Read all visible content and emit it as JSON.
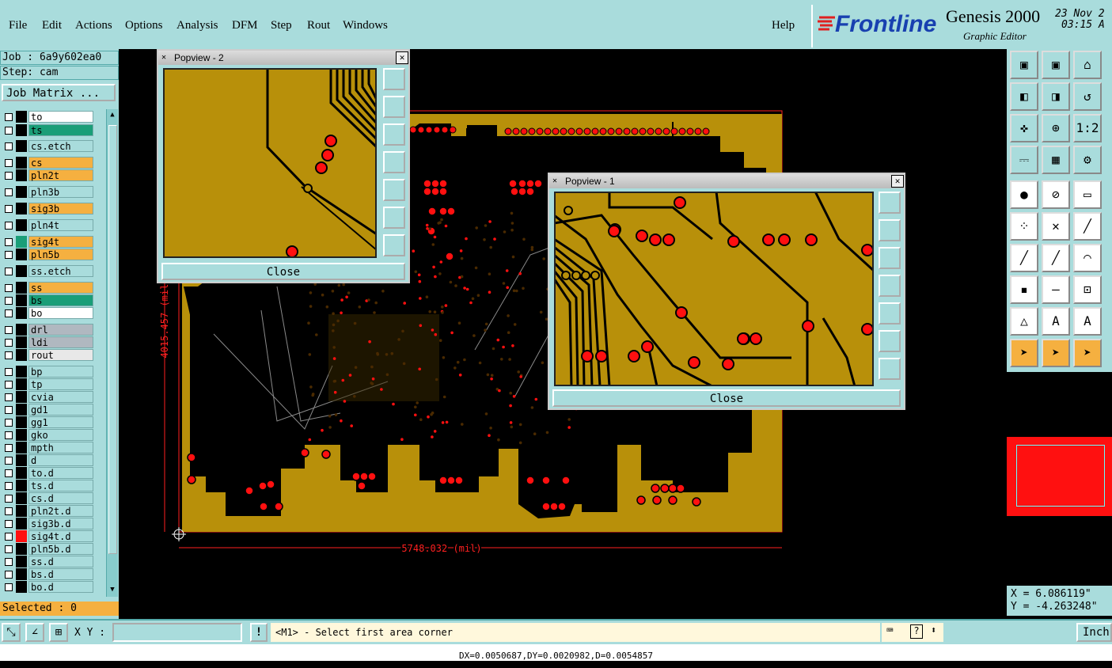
{
  "menu": {
    "items": [
      "File",
      "Edit",
      "Actions",
      "Options",
      "Analysis",
      "DFM",
      "Step",
      "Rout",
      "Windows"
    ],
    "help": "Help"
  },
  "brand": {
    "logo": "Frontline",
    "product": "Genesis 2000",
    "subtitle": "Graphic Editor",
    "date": "23 Nov 2",
    "time": "03:15 A"
  },
  "job": {
    "job_label": "Job : 6a9y602ea0",
    "step_label": "Step: cam",
    "matrix_button": "Job Matrix ...",
    "selected": "Selected : 0"
  },
  "layers": [
    {
      "name": "to",
      "color": "#ffffff",
      "fill": "#ffffff"
    },
    {
      "name": "ts",
      "color": "#1a9e78",
      "fill": "#1a9e78"
    },
    {
      "name": "cs.etch",
      "color": "#a9dcdc",
      "fill": "#a9dcdc"
    },
    {
      "name": "cs",
      "color": "#f5b040",
      "fill": "#f5b040"
    },
    {
      "name": "pln2t",
      "color": "#f5b040",
      "fill": "#f5b040"
    },
    {
      "name": "pln3b",
      "color": "#a9dcdc",
      "fill": "#a9dcdc"
    },
    {
      "name": "sig3b",
      "color": "#f5b040",
      "fill": "#f5b040"
    },
    {
      "name": "pln4t",
      "color": "#a9dcdc",
      "fill": "#a9dcdc"
    },
    {
      "name": "sig4t",
      "color": "#f5b040",
      "fill": "#f5b040"
    },
    {
      "name": "pln5b",
      "color": "#f5b040",
      "fill": "#f5b040"
    },
    {
      "name": "ss.etch",
      "color": "#a9dcdc",
      "fill": "#a9dcdc"
    },
    {
      "name": "ss",
      "color": "#f5b040",
      "fill": "#f5b040"
    },
    {
      "name": "bs",
      "color": "#1a9e78",
      "fill": "#1a9e78"
    },
    {
      "name": "bo",
      "color": "#ffffff",
      "fill": "#ffffff"
    },
    {
      "name": "drl",
      "color": "#b0b8c0",
      "fill": "#b0b8c0"
    },
    {
      "name": "ldi",
      "color": "#b0b8c0",
      "fill": "#b0b8c0"
    },
    {
      "name": "rout",
      "color": "#e8e8e8",
      "fill": "#e8e8e8"
    },
    {
      "name": "bp",
      "color": "#a9dcdc",
      "fill": "#a9dcdc"
    },
    {
      "name": "tp",
      "color": "#a9dcdc",
      "fill": "#a9dcdc"
    },
    {
      "name": "cvia",
      "color": "#a9dcdc",
      "fill": "#a9dcdc"
    },
    {
      "name": "gd1",
      "color": "#a9dcdc",
      "fill": "#a9dcdc"
    },
    {
      "name": "gg1",
      "color": "#a9dcdc",
      "fill": "#a9dcdc"
    },
    {
      "name": "gko",
      "color": "#a9dcdc",
      "fill": "#a9dcdc"
    },
    {
      "name": "mpth",
      "color": "#a9dcdc",
      "fill": "#a9dcdc"
    },
    {
      "name": "d",
      "color": "#a9dcdc",
      "fill": "#a9dcdc"
    },
    {
      "name": "to.d",
      "color": "#a9dcdc",
      "fill": "#a9dcdc"
    },
    {
      "name": "ts.d",
      "color": "#a9dcdc",
      "fill": "#a9dcdc"
    },
    {
      "name": "cs.d",
      "color": "#a9dcdc",
      "fill": "#a9dcdc"
    },
    {
      "name": "pln2t.d",
      "color": "#a9dcdc",
      "fill": "#a9dcdc"
    },
    {
      "name": "sig3b.d",
      "color": "#a9dcdc",
      "fill": "#a9dcdc"
    },
    {
      "name": "sig4t.d",
      "color": "#a9dcdc",
      "fill": "#a9dcdc"
    },
    {
      "name": "pln5b.d",
      "color": "#a9dcdc",
      "fill": "#a9dcdc"
    },
    {
      "name": "ss.d",
      "color": "#a9dcdc",
      "fill": "#a9dcdc"
    },
    {
      "name": "bs.d",
      "color": "#a9dcdc",
      "fill": "#a9dcdc"
    },
    {
      "name": "bo.d",
      "color": "#a9dcdc",
      "fill": "#a9dcdc"
    }
  ],
  "canvas": {
    "width_dim": "5748.032 (mil)",
    "height_dim": "4015.457 (mil)",
    "board_color": "#b8900a",
    "pad_color": "#ff1010",
    "outline_color": "#ff2020"
  },
  "popview2": {
    "title": "Popview - 2",
    "close": "Close"
  },
  "popview1": {
    "title": "Popview - 1",
    "close": "Close"
  },
  "coords": {
    "x": "X =  6.086119\"",
    "y": "Y = -4.263248\""
  },
  "bottom": {
    "xy_label": "X Y :",
    "xy_value": "",
    "prompt": "<M1> - Select first area corner",
    "units": "Inch"
  },
  "status": "DX=0.0050687,DY=0.0020982,D=0.0054857",
  "colors": {
    "panel": "#a9dcdc",
    "selected_bar": "#f5b040"
  }
}
